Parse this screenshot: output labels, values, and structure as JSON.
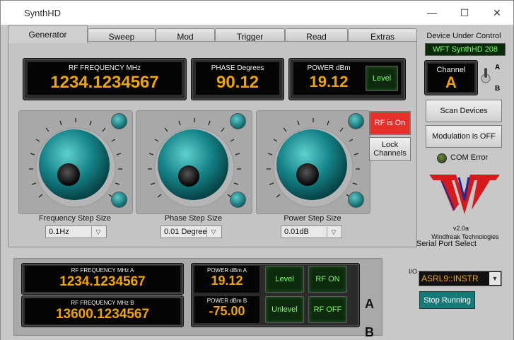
{
  "window": {
    "title": "SynthHD",
    "minimize": "—",
    "maximize": "☐",
    "close": "✕"
  },
  "tabs": [
    {
      "label": "Generator",
      "active": true
    },
    {
      "label": "Sweep"
    },
    {
      "label": "Mod"
    },
    {
      "label": "Trigger"
    },
    {
      "label": "Read"
    },
    {
      "label": "Extras"
    }
  ],
  "generator": {
    "rf_frequency": {
      "label": "RF  FREQUENCY MHz",
      "value": "1234.1234567"
    },
    "phase": {
      "label": "PHASE Degrees",
      "value": "90.12"
    },
    "power": {
      "label": "POWER dBm",
      "value": "19.12",
      "level_label": "Level"
    },
    "rf_button": "RF is On",
    "lock_button": "Lock Channels",
    "freq_step": {
      "label": "Frequency Step Size",
      "value": "0.1Hz"
    },
    "phase_step": {
      "label": "Phase Step Size",
      "value": "0.01 Degree"
    },
    "power_step": {
      "label": "Power Step Size",
      "value": "0.01dB"
    }
  },
  "device": {
    "header": "Device Under Control",
    "name": "WFT SynthHD 208",
    "channel_label": "Channel",
    "channel_value": "A",
    "switch_a": "A",
    "switch_b": "B",
    "scan_button": "Scan Devices",
    "modulation_button": "Modulation is OFF",
    "com_error": "COM Error",
    "version": "v2.0a",
    "company": "Windfreak Technologies"
  },
  "status": {
    "a": {
      "freq_label": "RF  FREQUENCY MHz A",
      "freq": "1234.1234567",
      "power_label": "POWER dBm A",
      "power": "19.12",
      "level": "Level",
      "rf": "RF ON",
      "tag": "A"
    },
    "b": {
      "freq_label": "RF  FREQUENCY MHz B",
      "freq": "13600.1234567",
      "power_label": "POWER dBm B",
      "power": "-75.00",
      "level": "Unlevel",
      "rf": "RF OFF",
      "tag": "B"
    }
  },
  "serial": {
    "label": "Serial Port Select",
    "io_glyph": "I/O",
    "port": "ASRL9::INSTR",
    "stop_button": "Stop Running"
  },
  "colors": {
    "lcd_text": "#f0a400",
    "led_green": "#7dff6a",
    "rf_on_red": "#e8302a",
    "knob_teal": "#1a8b8f",
    "device_lcd": "#0a2a0a"
  }
}
